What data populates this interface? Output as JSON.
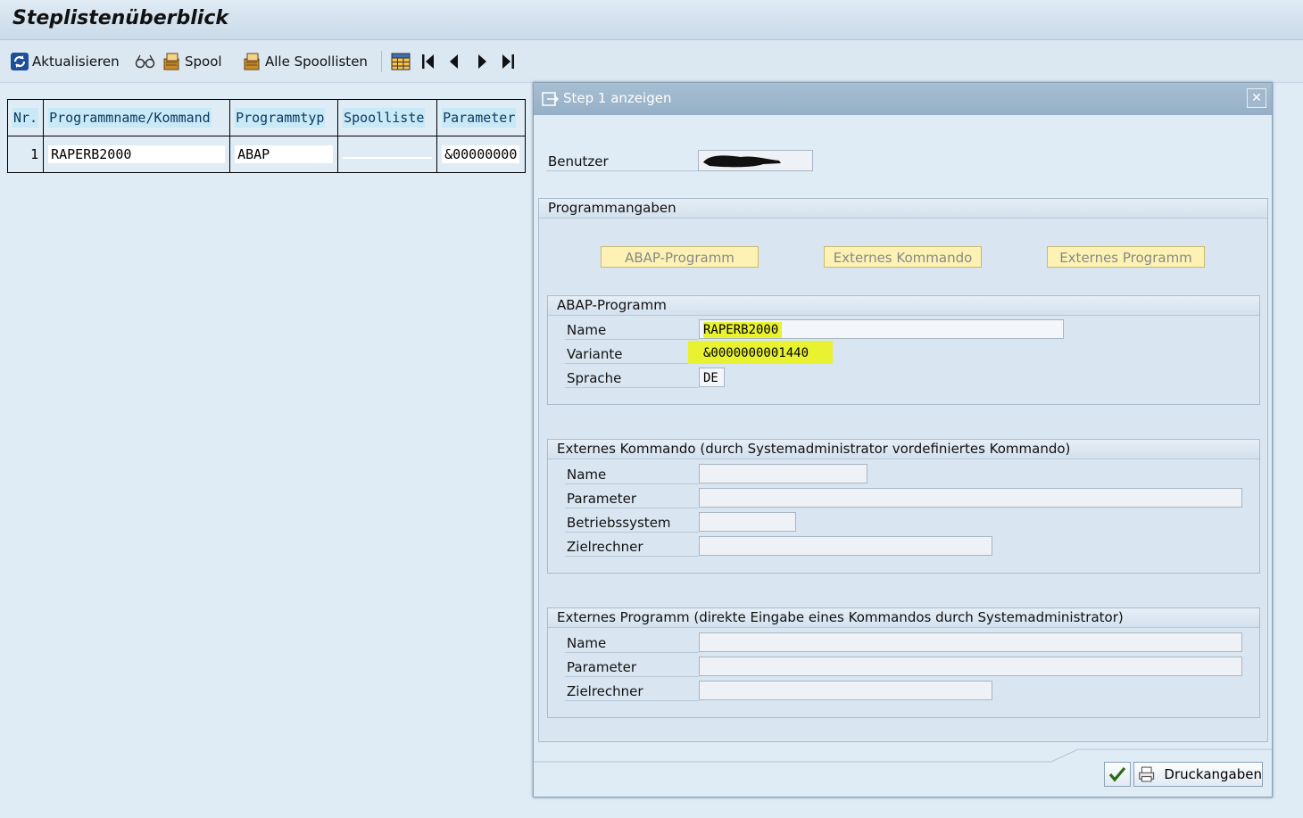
{
  "window": {
    "title": "Steplistenüberblick"
  },
  "toolbar": {
    "refresh_label": "Aktualisieren",
    "spool_label": "Spool",
    "all_spool_label": "Alle Spoollisten"
  },
  "table": {
    "headers": [
      "Nr.",
      "Programmname/Kommand",
      "Programmtyp",
      "Spoolliste",
      "Parameter"
    ],
    "rows": [
      {
        "nr": "1",
        "program": "RAPERB2000",
        "type": "ABAP",
        "spool": "",
        "param": "&00000000"
      }
    ]
  },
  "dialog": {
    "title": "Step  1 anzeigen",
    "close_symbol": "✕",
    "user_label": "Benutzer",
    "user_value": "",
    "program_section_title": "Programmangaben",
    "buttons": {
      "abap": "ABAP-Programm",
      "ext_cmd": "Externes Kommando",
      "ext_prog": "Externes Programm"
    },
    "abap_group": {
      "title": "ABAP-Programm",
      "name_label": "Name",
      "name_value": "RAPERB2000",
      "variant_label": "Variante",
      "variant_value": "&0000000001440",
      "lang_label": "Sprache",
      "lang_value": "DE"
    },
    "ext_cmd_group": {
      "title": "Externes Kommando (durch Systemadministrator vordefiniertes Kommando)",
      "name_label": "Name",
      "param_label": "Parameter",
      "os_label": "Betriebssystem",
      "host_label": "Zielrechner",
      "name_value": "",
      "param_value": "",
      "os_value": "",
      "host_value": ""
    },
    "ext_prog_group": {
      "title": "Externes Programm (direkte Eingabe eines Kommandos durch Systemadministrator)",
      "name_label": "Name",
      "param_label": "Parameter",
      "host_label": "Zielrechner",
      "name_value": "",
      "param_value": "",
      "host_value": ""
    },
    "print_button_label": "Druckangaben"
  },
  "colors": {
    "highlight": "#e8f230",
    "dialog_header": "#9fb7cc",
    "header_cell_bg": "#c9e9f6",
    "button_bg": "#fdf2b4"
  }
}
